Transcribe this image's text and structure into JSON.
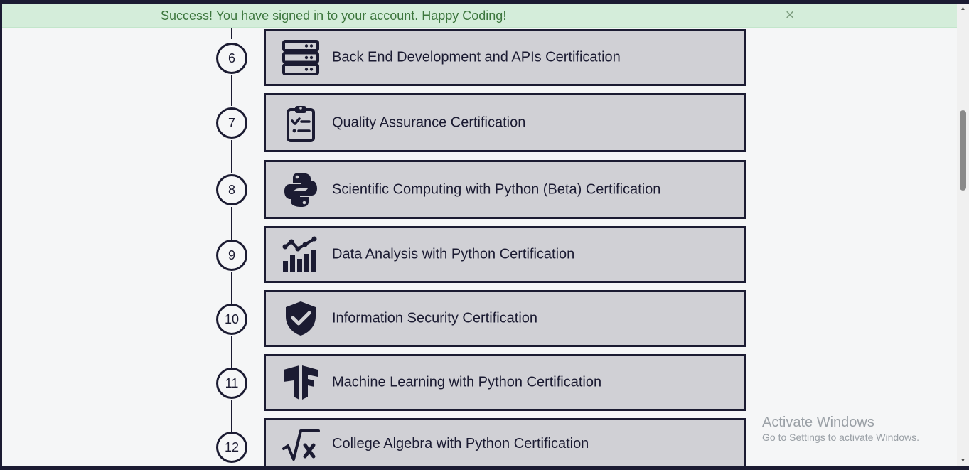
{
  "alert": {
    "message": "Success! You have signed in to your account. Happy Coding!",
    "close_glyph": "×",
    "color": "#3c763d",
    "background": "#d4edda"
  },
  "certifications": [
    {
      "number": "6",
      "label": "Back End Development and APIs Certification",
      "icon": "server-icon"
    },
    {
      "number": "7",
      "label": "Quality Assurance Certification",
      "icon": "clipboard-check-icon"
    },
    {
      "number": "8",
      "label": "Scientific Computing with Python (Beta) Certification",
      "icon": "python-icon"
    },
    {
      "number": "9",
      "label": "Data Analysis with Python Certification",
      "icon": "chart-icon"
    },
    {
      "number": "10",
      "label": "Information Security Certification",
      "icon": "shield-check-icon"
    },
    {
      "number": "11",
      "label": "Machine Learning with Python Certification",
      "icon": "tensorflow-icon"
    },
    {
      "number": "12",
      "label": "College Algebra with Python Certification",
      "icon": "sqrt-x-icon"
    }
  ],
  "watermark": {
    "title": "Activate Windows",
    "subtitle": "Go to Settings to activate Windows."
  },
  "theme": {
    "dark": "#1b1b32",
    "card_background": "#d0d0d5",
    "page_background": "#f5f6f7"
  }
}
